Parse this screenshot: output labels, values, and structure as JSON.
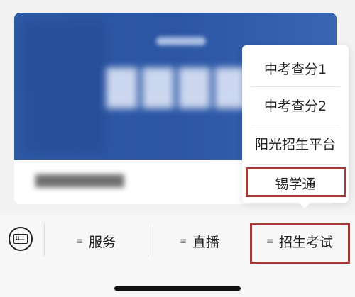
{
  "menu": {
    "items": [
      "中考查分1",
      "中考查分2",
      "阳光招生平台",
      "锡学通"
    ]
  },
  "tabbar": {
    "tabs": [
      {
        "label": "服务",
        "icon": "menu-lines-icon"
      },
      {
        "label": "直播",
        "icon": "menu-lines-icon"
      },
      {
        "label": "招生考试",
        "icon": "menu-lines-icon"
      }
    ],
    "keyboard_icon": "keyboard-icon"
  },
  "colors": {
    "banner": "#2f5aa6",
    "highlight": "#a33b3b"
  }
}
